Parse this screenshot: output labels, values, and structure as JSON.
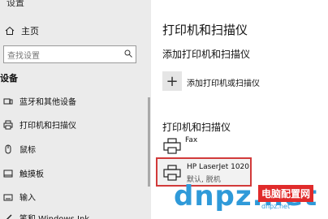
{
  "sidebar": {
    "top_label": "设置",
    "home_label": "主页",
    "search_placeholder": "查找设置",
    "section_label": "设备",
    "items": [
      {
        "label": "蓝牙和其他设备",
        "icon": "bluetooth-icon"
      },
      {
        "label": "打印机和扫描仪",
        "icon": "printer-icon"
      },
      {
        "label": "鼠标",
        "icon": "mouse-icon"
      },
      {
        "label": "触摸板",
        "icon": "touchpad-icon"
      },
      {
        "label": "输入",
        "icon": "keyboard-icon"
      },
      {
        "label": "笔和 Windows Ink",
        "icon": "pen-icon"
      }
    ]
  },
  "main": {
    "title": "打印机和扫描仪",
    "add_section_title": "添加打印机和扫描仪",
    "add_button_label": "添加打印机或扫描仪",
    "printers_section_title": "打印机和扫描仪",
    "printers": [
      {
        "name": "Fax",
        "status": ""
      },
      {
        "name": "HP LaserJet 1020",
        "status": "默认, 脱机"
      }
    ]
  },
  "watermark": {
    "text": "dnpz.net",
    "tag": "电脑配置网",
    "sub": "dnpz.net"
  },
  "colors": {
    "sidebar_bg": "#ebebeb",
    "selection_border": "#d23a3a",
    "watermark_blue": "#2f9ad9",
    "watermark_red": "#e02b2b"
  }
}
